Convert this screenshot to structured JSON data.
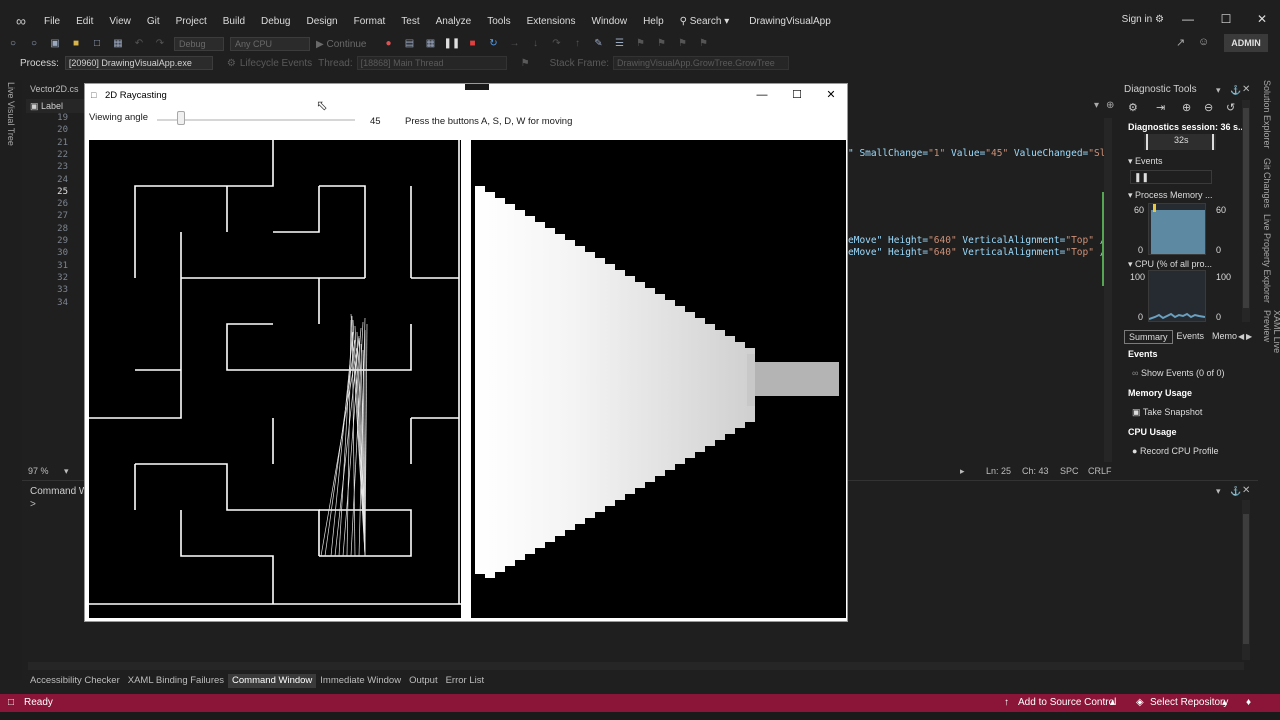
{
  "menu": {
    "items": [
      "File",
      "Edit",
      "View",
      "Git",
      "Project",
      "Build",
      "Debug",
      "Design",
      "Format",
      "Test",
      "Analyze",
      "Tools",
      "Extensions",
      "Window",
      "Help"
    ],
    "search": "Search",
    "solution": "DrawingVisualApp",
    "sign_in": "Sign in"
  },
  "toolbar": {
    "config": "Debug",
    "platform": "Any CPU",
    "continue": "Continue",
    "admin": "ADMIN"
  },
  "process_bar": {
    "process_label": "Process:",
    "process_value": "[20960] DrawingVisualApp.exe",
    "lifecycle": "Lifecycle Events",
    "thread_label": "Thread:",
    "thread_value": "[18868] Main Thread",
    "stack_label": "Stack Frame:",
    "stack_value": "DrawingVisualApp.GrowTree.GrowTree"
  },
  "left_rail": {
    "label": "Live Visual Tree"
  },
  "editor": {
    "tab": "Vector2D.cs",
    "dropdown": "Label",
    "line_numbers": [
      "19",
      "20",
      "21",
      "22",
      "23",
      "24",
      "25",
      "26",
      "27",
      "28",
      "29",
      "30",
      "31",
      "32",
      "33",
      "34"
    ],
    "code_lines": [
      {
        "a": "\" SmallChange=",
        "b": "\"1\"",
        "c": " Value=",
        "d": "\"45\"",
        "e": " ValueChanged=",
        "f": "\"Sl"
      },
      {
        "a": "eMove\" Height=",
        "b": "\"640\"",
        "c": " VerticalAlignment=",
        "d": "\"Top\"",
        "e": " />",
        "f": ""
      },
      {
        "a": "eMove\" Height=",
        "b": "\"640\"",
        "c": " VerticalAlignment=",
        "d": "\"Top\"",
        "e": " />",
        "f": ""
      }
    ],
    "zoom": "97 %",
    "ln": "Ln: 25",
    "ch": "Ch: 43",
    "spc": "SPC",
    "crlf": "CRLF"
  },
  "command_window": {
    "title": "Command W",
    "prompt": ">"
  },
  "bottom_tabs": [
    "Accessibility Checker",
    "XAML Binding Failures",
    "Command Window",
    "Immediate Window",
    "Output",
    "Error List"
  ],
  "status": {
    "ready": "Ready",
    "source_control": "Add to Source Control",
    "repository": "Select Repository"
  },
  "diagnostics": {
    "title": "Diagnostic Tools",
    "session": "Diagnostics session: 36 s...",
    "time_marker": "32s",
    "events": "Events",
    "process_memory": "Process Memory ...",
    "mem_max_left": "60",
    "mem_max_right": "60",
    "mem_min_left": "0",
    "mem_min_right": "0",
    "cpu_header": "CPU (% of all pro...",
    "cpu_max_left": "100",
    "cpu_max_right": "100",
    "cpu_min_left": "0",
    "cpu_min_right": "0",
    "tabs": [
      "Summary",
      "Events",
      "Memo"
    ],
    "events_section": "Events",
    "show_events": "Show Events (0 of 0)",
    "memory_usage": "Memory Usage",
    "take_snapshot": "Take Snapshot",
    "cpu_usage": "CPU Usage",
    "record_cpu": "Record CPU Profile"
  },
  "right_rail": {
    "solution_explorer": "Solution Explorer",
    "git_changes": "Git Changes",
    "live_property": "Live Property Explorer",
    "xaml_preview": "XAML Live Preview"
  },
  "app_window": {
    "title": "2D Raycasting",
    "viewing_angle_label": "Viewing angle",
    "slider_value": 45,
    "slider_text": "45",
    "hint": "Press the buttons A, S, D, W for moving"
  }
}
